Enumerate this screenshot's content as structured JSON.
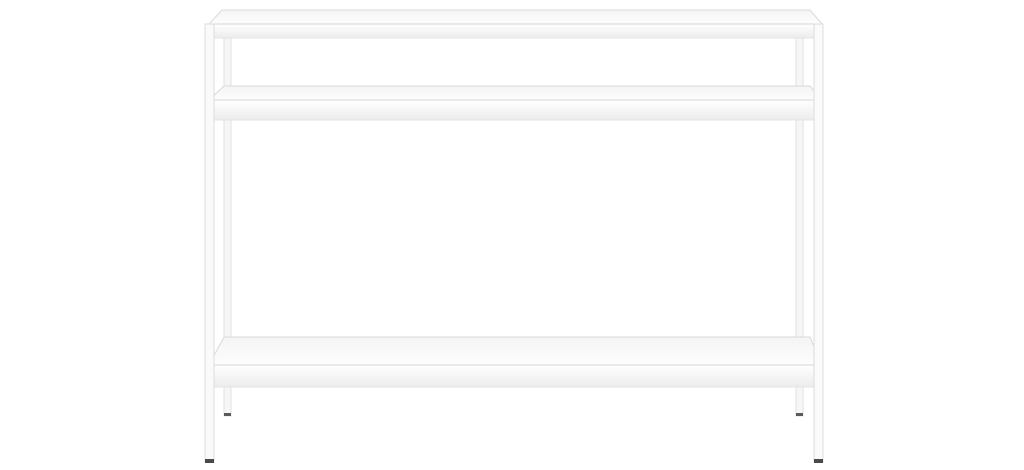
{
  "image": {
    "subject": "console-table-three-shelves",
    "colors": {
      "background": "#ffffff",
      "frame": "#f7f7f7",
      "frame_edge": "#dcdcdc",
      "shelf_top": "#fbfbfb",
      "shelf_edge": "#d6d6d6",
      "shadow": "#e6e6e6",
      "foot": "#4a4a4a"
    }
  }
}
